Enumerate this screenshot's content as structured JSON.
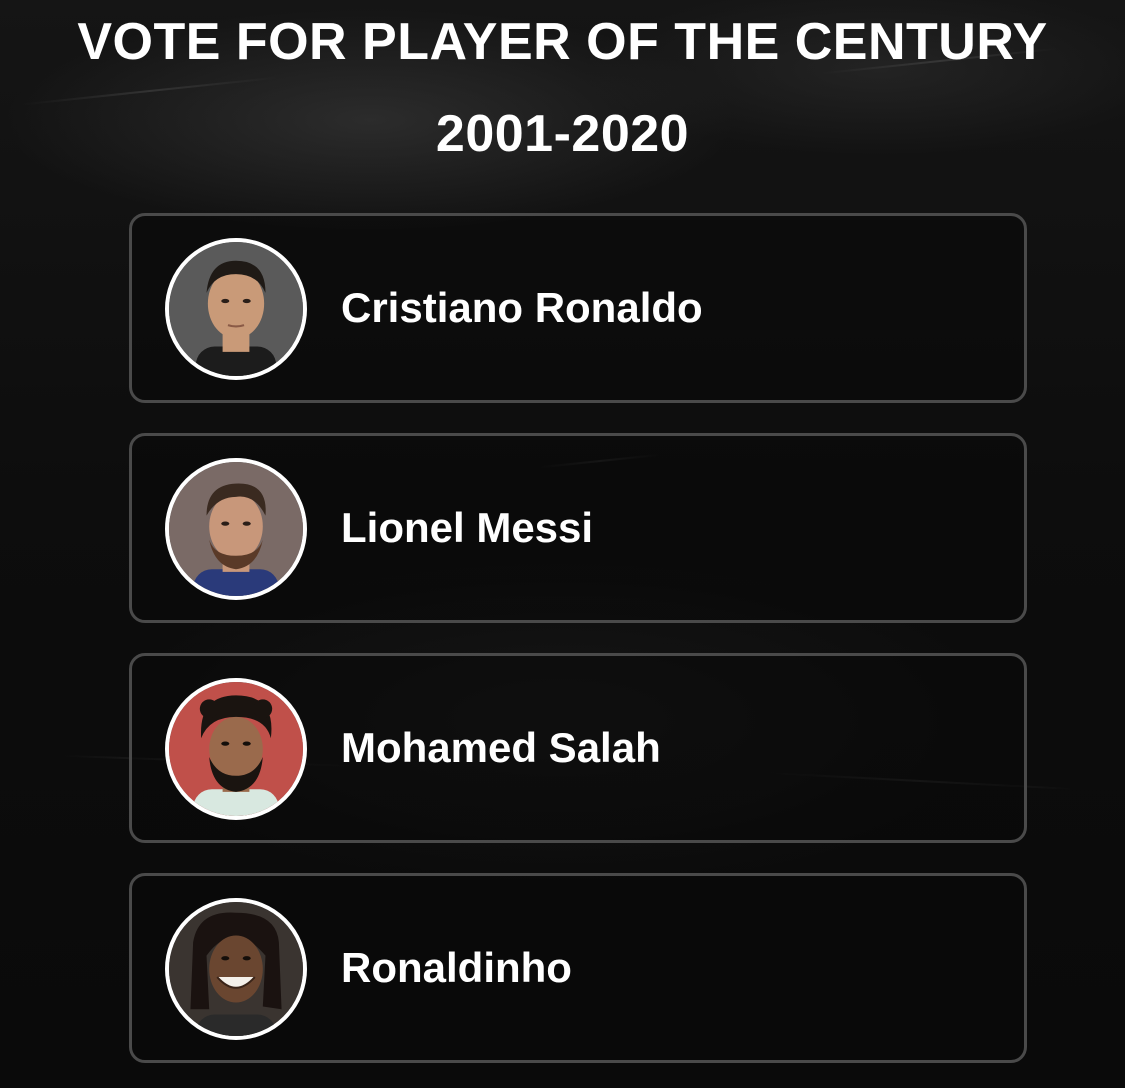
{
  "header": {
    "title_line1": "VOTE FOR PLAYER OF THE CENTURY",
    "title_line2": "2001-2020"
  },
  "players": [
    {
      "name": "Cristiano Ronaldo",
      "avatar_icon": "player-photo",
      "bg": "#5a5a5a",
      "skin": "#c99a78",
      "hair": "#1f1a16"
    },
    {
      "name": "Lionel Messi",
      "avatar_icon": "player-photo",
      "bg": "#7a6a66",
      "skin": "#c8977a",
      "hair": "#3a2a20"
    },
    {
      "name": "Mohamed Salah",
      "avatar_icon": "player-photo",
      "bg": "#c0504a",
      "skin": "#9a6a4c",
      "hair": "#1a1410"
    },
    {
      "name": "Ronaldinho",
      "avatar_icon": "player-photo",
      "bg": "#3a3430",
      "skin": "#6a4630",
      "hair": "#1a1210"
    }
  ],
  "colors": {
    "background": "#0f0f0f",
    "card_border": "#4a4a4a",
    "text": "#ffffff"
  }
}
